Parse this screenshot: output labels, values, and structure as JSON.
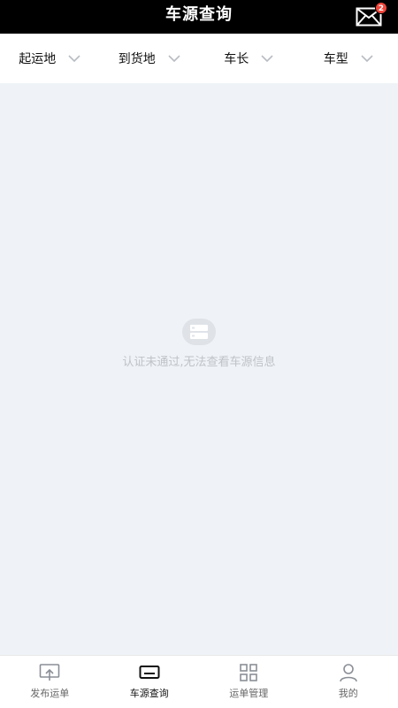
{
  "header": {
    "title": "车源查询",
    "mail_icon": "mail-icon",
    "unread_count": "2"
  },
  "filters": [
    {
      "label": "起运地",
      "icon": "chevron-down-icon"
    },
    {
      "label": "到货地",
      "icon": "chevron-down-icon"
    },
    {
      "label": "车长",
      "icon": "chevron-down-icon"
    },
    {
      "label": "车型",
      "icon": "chevron-down-icon"
    }
  ],
  "empty_state": {
    "icon": "server-icon",
    "message": "认证未通过,无法查看车源信息"
  },
  "tabbar": {
    "active": "车源查询",
    "tabs": [
      {
        "label": "发布运单",
        "icon": "publish-icon"
      },
      {
        "label": "车源查询",
        "icon": "vehicle-search-icon"
      },
      {
        "label": "运单管理",
        "icon": "grid-icon"
      },
      {
        "label": "我的",
        "icon": "user-icon"
      }
    ]
  },
  "colors": {
    "header_bg": "#000000",
    "page_bg": "#eff3f7",
    "badge": "#f2463b",
    "muted_text": "#bfc3c8"
  }
}
